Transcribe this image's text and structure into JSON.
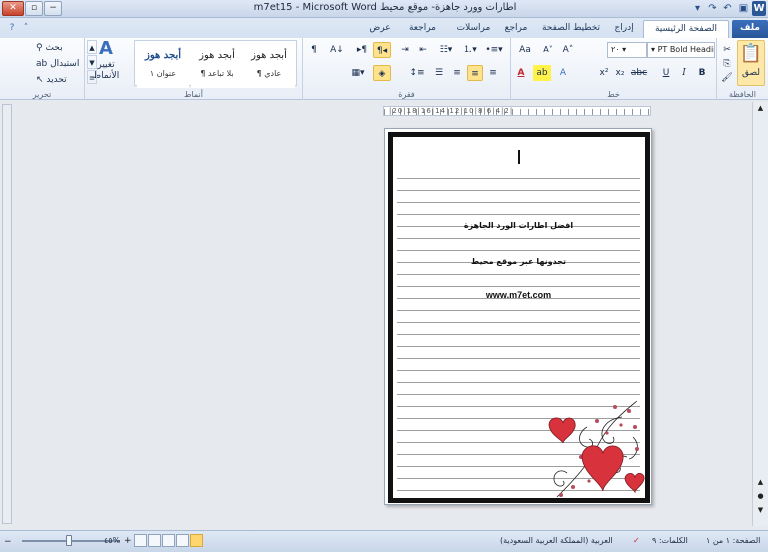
{
  "window": {
    "title": "m7et15 - Microsoft Word اطارات وورد جاهزة- موقع محيط",
    "minimize": "−",
    "restore": "▫",
    "close": "✕"
  },
  "qat": {
    "word": "W",
    "save": "💾",
    "undo": "↶",
    "redo": "↷"
  },
  "tabs": {
    "file": "ملف",
    "home": "الصفحة الرئيسية",
    "insert": "إدراج",
    "layout": "تخطيط الصفحة",
    "references": "مراجع",
    "mailings": "مراسلات",
    "review": "مراجعة",
    "view": "عرض"
  },
  "ribbon": {
    "clipboard": {
      "label": "الحافظة",
      "paste": "لصق"
    },
    "font": {
      "label": "خط",
      "font_name": "PT Bold Heading",
      "font_size": "٢٠",
      "bold": "B",
      "italic": "I",
      "underline": "U",
      "strike": "abc",
      "subscript": "x₂",
      "superscript": "x²",
      "grow": "A˄",
      "shrink": "A˅",
      "case": "Aa",
      "clear": "A",
      "highlight": "ab",
      "color": "A"
    },
    "paragraph": {
      "label": "فقرة",
      "pilcrow": "¶",
      "sort": "A↓"
    },
    "styles": {
      "label": "أنماط",
      "items": [
        {
          "sample": "أبجد هوز",
          "name": "¶ عادي"
        },
        {
          "sample": "أبجد هوز",
          "name": "¶ بلا تباعد"
        },
        {
          "sample": "أبجد هوز",
          "name": "عنوان ١"
        }
      ],
      "change": "تغيير الأنماط"
    },
    "editing": {
      "label": "تحرير",
      "find": "بحث",
      "replace": "استبدال",
      "select": "تحديد"
    }
  },
  "ruler": {
    "text": "|20|18|16|14|12|10|8|6|4|2|"
  },
  "document": {
    "line1": "افضل اطارات الورد الجاهزة",
    "line2": "تجدونها عبر موقع محيط",
    "line3": "www.m7et.com"
  },
  "status": {
    "page": "الصفحة: ١ من ١",
    "words": "الكلمات: ٩",
    "language": "العربية (المملكة العربية السعودية)",
    "zoom": "٤٥%"
  },
  "colors": {
    "accent": "#2b5797",
    "highlight": "#ffe38c",
    "heart": "#d8323c"
  }
}
